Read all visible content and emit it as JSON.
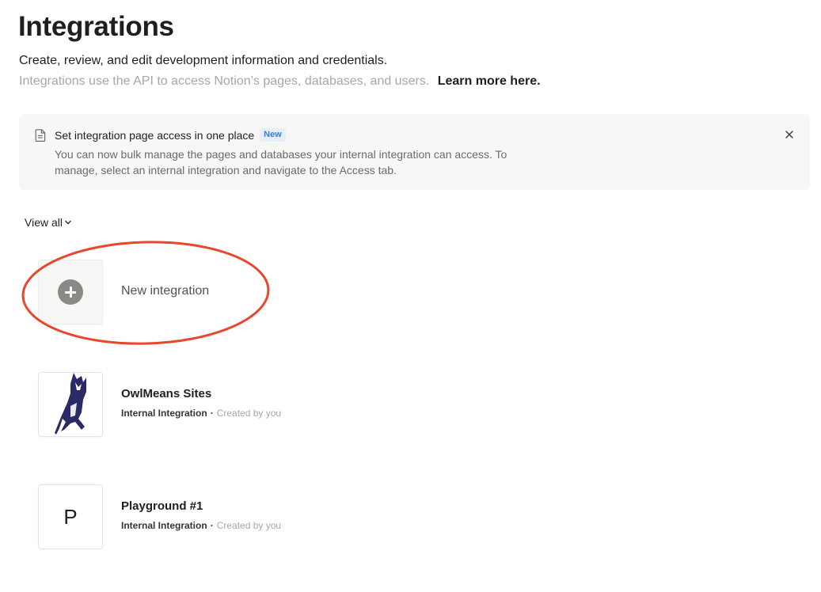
{
  "header": {
    "title": "Integrations",
    "subtitle": "Create, review, and edit development information and credentials.",
    "description": "Integrations use the API to access Notion’s pages, databases, and users.",
    "learn_more": "Learn more here."
  },
  "banner": {
    "title": "Set integration page access in one place",
    "badge": "New",
    "body": "You can now bulk manage the pages and databases your internal integration can access. To manage, select an internal integration and navigate to the Access tab.",
    "icon": "document-icon",
    "close_icon": "close-icon"
  },
  "filter": {
    "label": "View all",
    "icon": "chevron-down-icon"
  },
  "new_integration": {
    "label": "New integration",
    "icon": "plus-circle-icon"
  },
  "integrations": [
    {
      "name": "OwlMeans Sites",
      "type": "Internal Integration",
      "separator": "·",
      "created": "Created by you",
      "logo": "owl-logo-icon"
    },
    {
      "name": "Playground #1",
      "type": "Internal Integration",
      "separator": "·",
      "created": "Created by you",
      "logo_letter": "P"
    }
  ],
  "colors": {
    "annotation_ellipse": "#e8472c",
    "badge_bg": "#e6eff9",
    "badge_text": "#3e7ccc",
    "owl_logo": "#2b2a66",
    "banner_bg": "#f7f7f5"
  }
}
